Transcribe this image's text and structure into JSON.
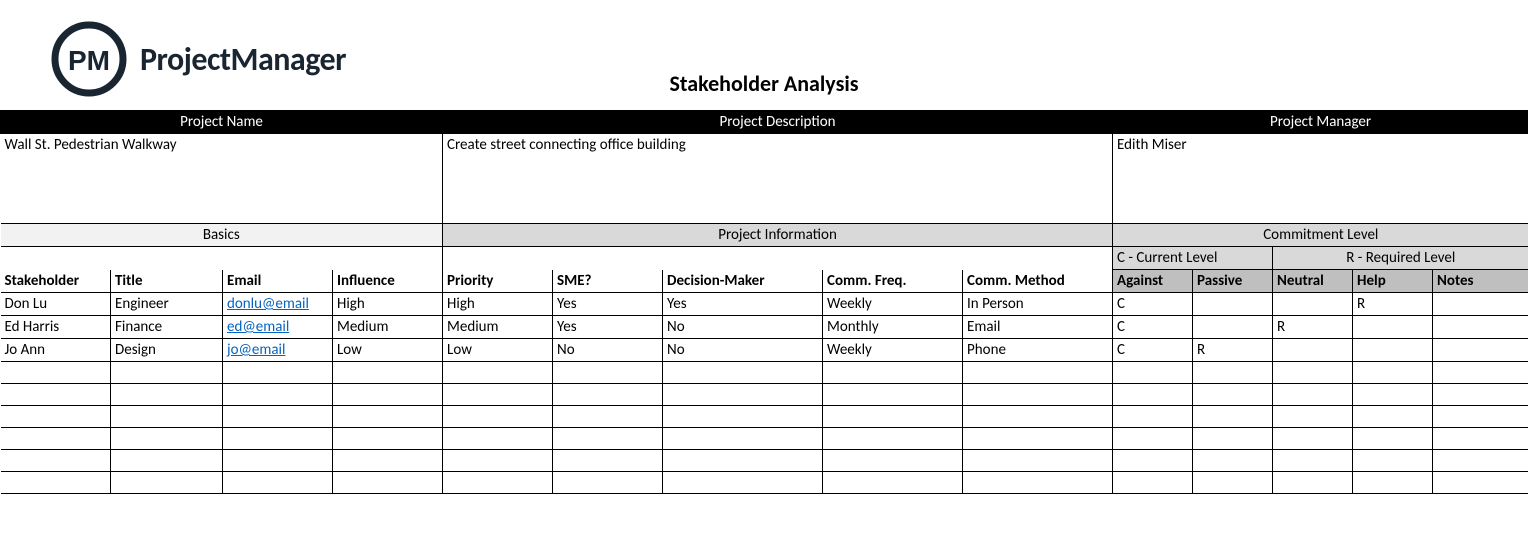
{
  "brand": "ProjectManager",
  "title": "Stakeholder Analysis",
  "projHeaders": {
    "name": "Project Name",
    "desc": "Project Description",
    "mgr": "Project Manager"
  },
  "proj": {
    "name": "Wall St. Pedestrian Walkway",
    "desc": "Create street connecting office building",
    "mgr": "Edith Miser"
  },
  "sections": {
    "basics": "Basics",
    "info": "Project Information",
    "commit": "Commitment Level"
  },
  "legend": {
    "current": "C - Current Level",
    "required": "R - Required Level"
  },
  "cols": {
    "stakeholder": "Stakeholder",
    "title": "Title",
    "email": "Email",
    "influence": "Influence",
    "priority": "Priority",
    "sme": "SME?",
    "decision": "Decision-Maker",
    "freq": "Comm. Freq.",
    "method": "Comm. Method",
    "against": "Against",
    "passive": "Passive",
    "neutral": "Neutral",
    "help": "Help",
    "notes": "Notes"
  },
  "rows": [
    {
      "stakeholder": "Don Lu",
      "title": "Engineer",
      "email": "donlu@email",
      "influence": "High",
      "priority": "High",
      "sme": "Yes",
      "decision": "Yes",
      "freq": "Weekly",
      "method": "In Person",
      "against": "C",
      "passive": "",
      "neutral": "",
      "help": "R",
      "notes": ""
    },
    {
      "stakeholder": "Ed Harris",
      "title": "Finance",
      "email": "ed@email",
      "influence": "Medium",
      "priority": "Medium",
      "sme": "Yes",
      "decision": "No",
      "freq": "Monthly",
      "method": "Email",
      "against": "C",
      "passive": "",
      "neutral": "R",
      "help": "",
      "notes": ""
    },
    {
      "stakeholder": "Jo Ann",
      "title": "Design",
      "email": "jo@email",
      "influence": "Low",
      "priority": "Low",
      "sme": "No",
      "decision": "No",
      "freq": "Weekly",
      "method": "Phone",
      "against": "C",
      "passive": "R",
      "neutral": "",
      "help": "",
      "notes": ""
    },
    {
      "stakeholder": "",
      "title": "",
      "email": "",
      "influence": "",
      "priority": "",
      "sme": "",
      "decision": "",
      "freq": "",
      "method": "",
      "against": "",
      "passive": "",
      "neutral": "",
      "help": "",
      "notes": ""
    },
    {
      "stakeholder": "",
      "title": "",
      "email": "",
      "influence": "",
      "priority": "",
      "sme": "",
      "decision": "",
      "freq": "",
      "method": "",
      "against": "",
      "passive": "",
      "neutral": "",
      "help": "",
      "notes": ""
    },
    {
      "stakeholder": "",
      "title": "",
      "email": "",
      "influence": "",
      "priority": "",
      "sme": "",
      "decision": "",
      "freq": "",
      "method": "",
      "against": "",
      "passive": "",
      "neutral": "",
      "help": "",
      "notes": ""
    },
    {
      "stakeholder": "",
      "title": "",
      "email": "",
      "influence": "",
      "priority": "",
      "sme": "",
      "decision": "",
      "freq": "",
      "method": "",
      "against": "",
      "passive": "",
      "neutral": "",
      "help": "",
      "notes": ""
    },
    {
      "stakeholder": "",
      "title": "",
      "email": "",
      "influence": "",
      "priority": "",
      "sme": "",
      "decision": "",
      "freq": "",
      "method": "",
      "against": "",
      "passive": "",
      "neutral": "",
      "help": "",
      "notes": ""
    },
    {
      "stakeholder": "",
      "title": "",
      "email": "",
      "influence": "",
      "priority": "",
      "sme": "",
      "decision": "",
      "freq": "",
      "method": "",
      "against": "",
      "passive": "",
      "neutral": "",
      "help": "",
      "notes": ""
    }
  ]
}
